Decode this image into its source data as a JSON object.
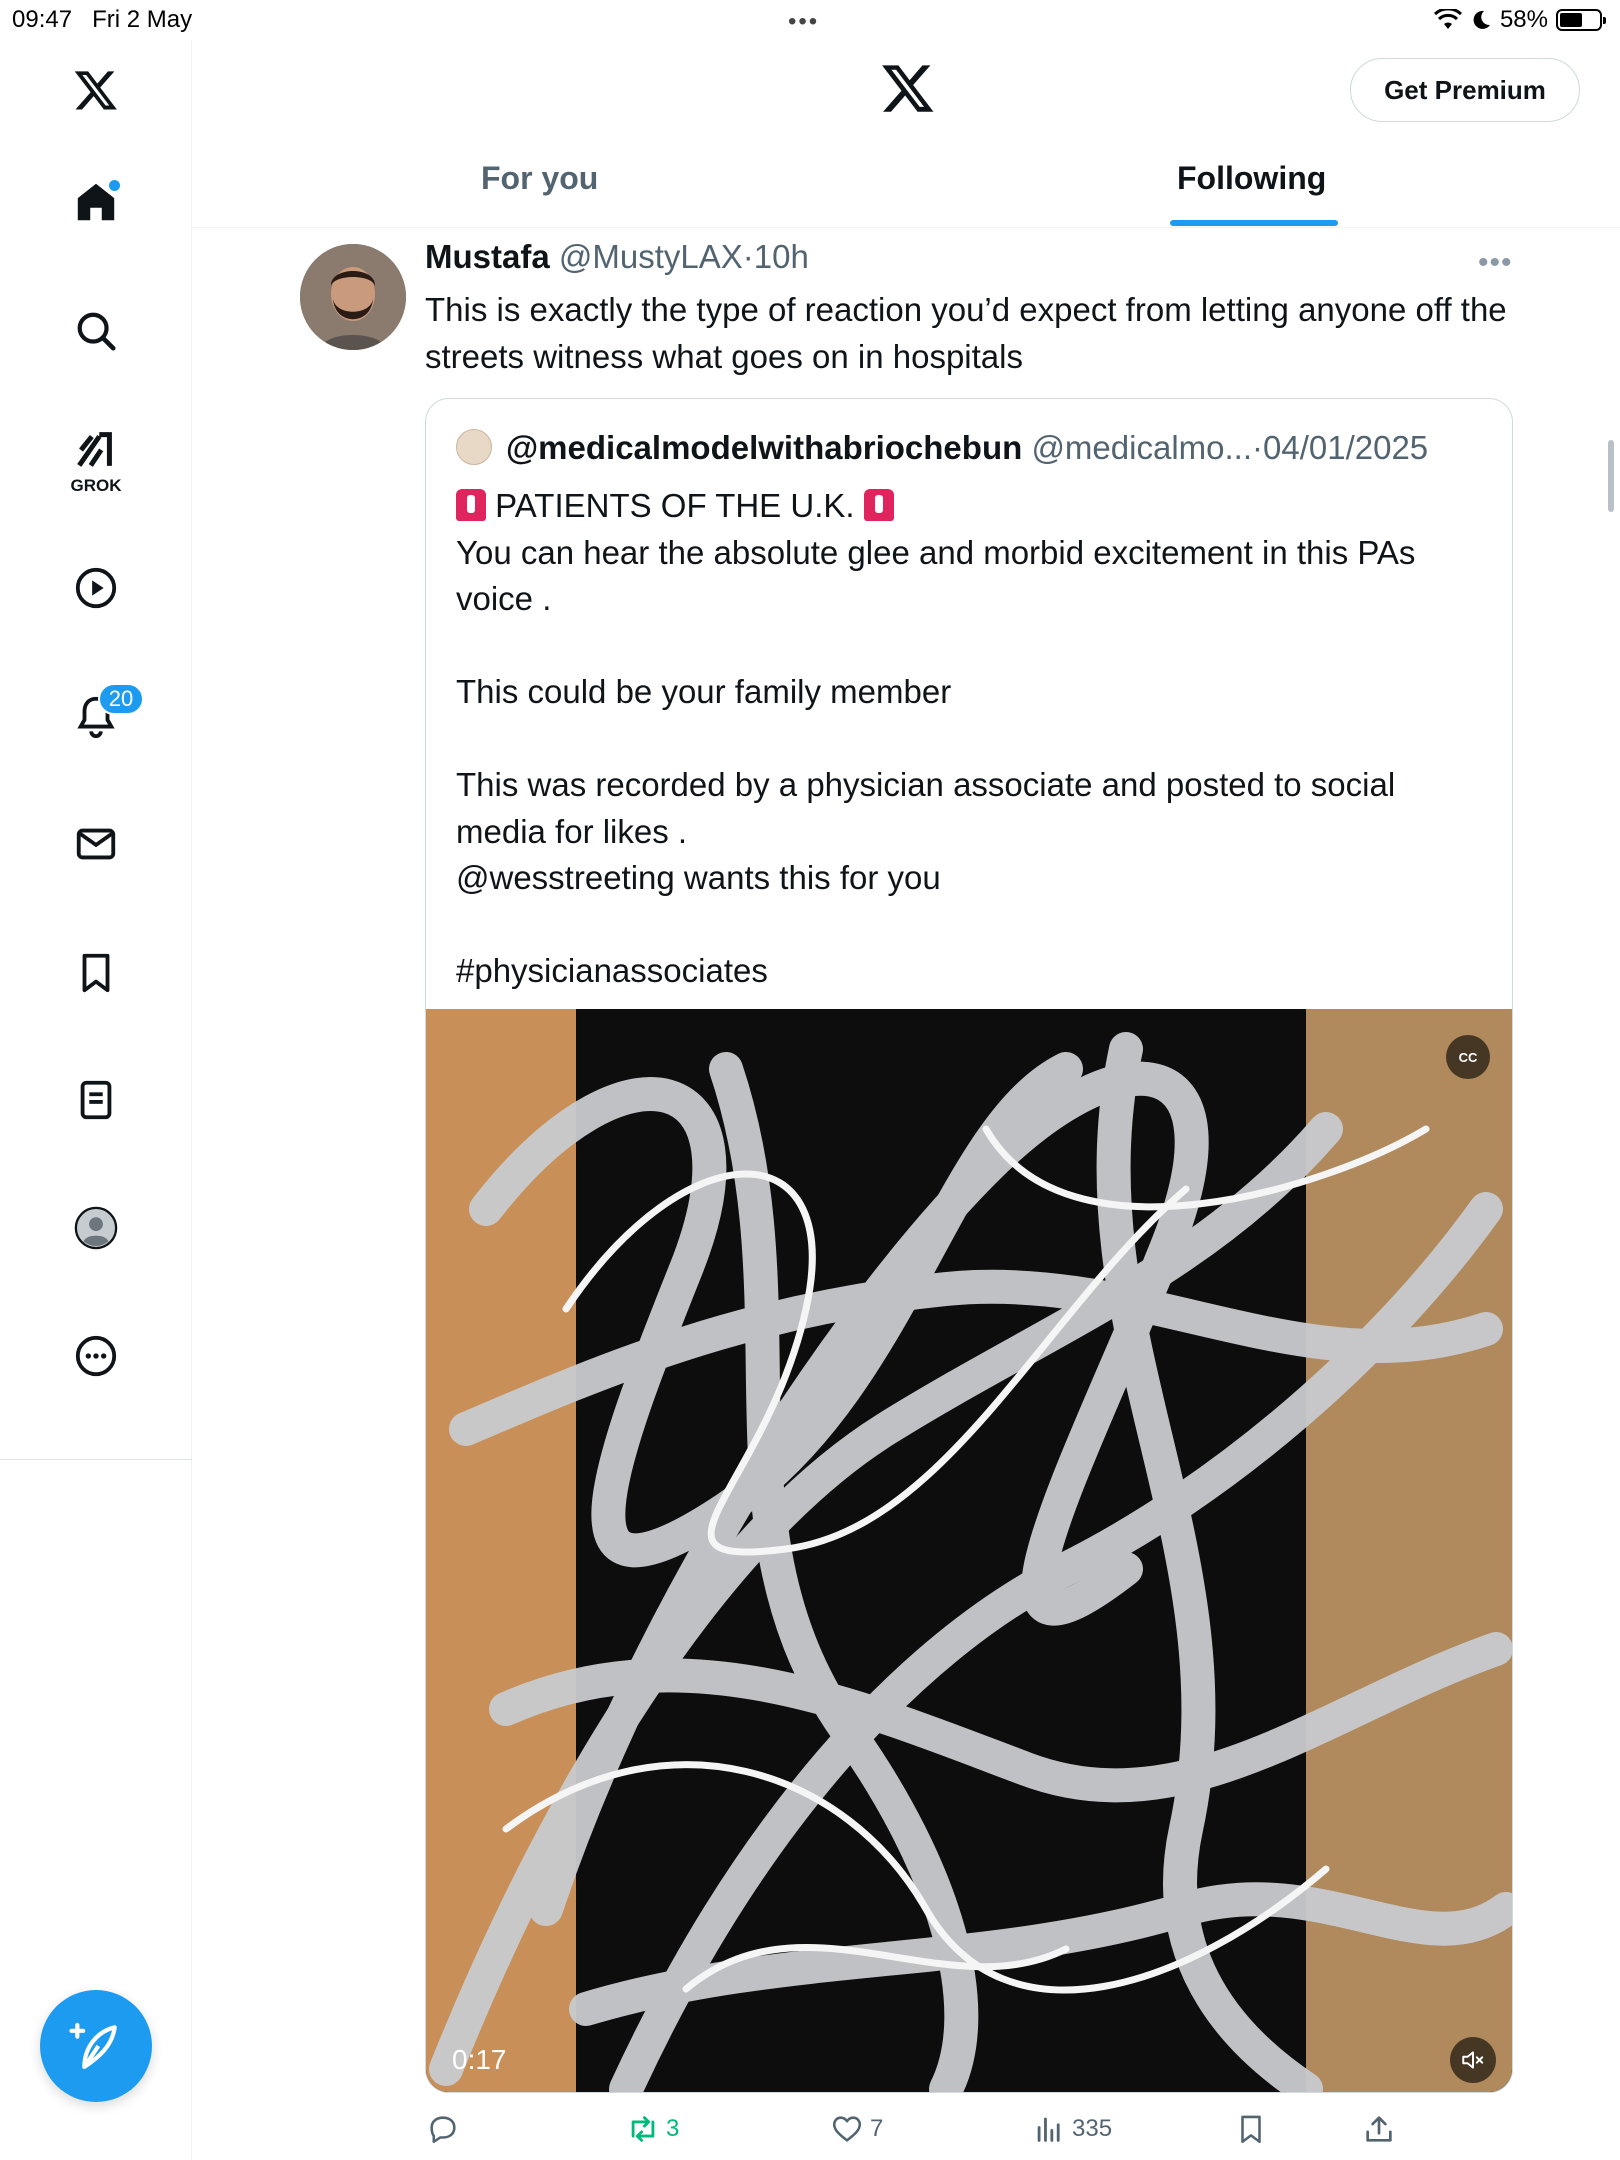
{
  "status_bar": {
    "time": "09:47",
    "date": "Fri 2 May",
    "dots": "•••",
    "battery_percent": "58%",
    "battery_level": 0.58
  },
  "sidebar": {
    "items": [
      {
        "name": "x-logo-icon"
      },
      {
        "name": "home-icon"
      },
      {
        "name": "search-icon"
      },
      {
        "name": "grok-icon",
        "label": "GROK"
      },
      {
        "name": "video-icon"
      },
      {
        "name": "notifications-icon",
        "badge": "20"
      },
      {
        "name": "messages-icon"
      },
      {
        "name": "bookmarks-icon"
      },
      {
        "name": "lists-icon"
      },
      {
        "name": "profile-icon"
      },
      {
        "name": "more-icon"
      }
    ],
    "compose_icon": "compose-icon"
  },
  "header": {
    "premium_label": "Get Premium",
    "tabs": [
      {
        "label": "For you",
        "active": false
      },
      {
        "label": "Following",
        "active": true
      }
    ],
    "accent": "#1d9bf0"
  },
  "tweet": {
    "author_name": "Mustafa",
    "handle": "@MustyLAX",
    "separator": "·",
    "time": "10h",
    "text": "This is exactly the type of reaction you’d expect from letting anyone off the streets witness what goes on in hospitals",
    "quote": {
      "name": "@medicalmodelwithabriochebun",
      "handle": "@medicalmo...",
      "separator": "·",
      "date": "04/01/2025",
      "line1_text": " PATIENTS OF THE U.K. ",
      "body": "You can hear the absolute glee and morbid excitement in this PAs voice .\n\nThis could be your family member\n\nThis was recorded by a physician associate and posted to social media for likes .\n@wesstreeting wants this for you\n\n#physicianassociates",
      "video": {
        "duration": "0:17",
        "cc_label": "CC"
      }
    },
    "actions": {
      "replies": "",
      "retweets": "3",
      "likes": "7",
      "views": "335"
    }
  }
}
